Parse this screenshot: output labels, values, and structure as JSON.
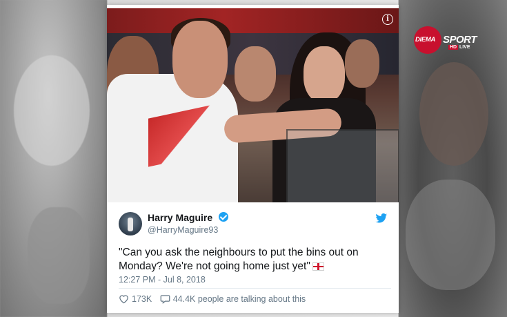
{
  "channel_logo": {
    "brand": "DIEMA",
    "name": "SPORT",
    "hd": "HD",
    "live": "LIVE",
    "color": "#c8102e"
  },
  "tweet": {
    "display_name": "Harry Maguire",
    "handle": "@HarryMaguire93",
    "text": "\"Can you ask the neighbours to put the bins out on Monday? We're not going home just yet\"",
    "timestamp": "12:27 PM - Jul 8, 2018",
    "likes": "173K",
    "replies": "44.4K people are talking about this",
    "verified_icon": "verified-badge-icon",
    "platform_icon": "twitter-bird-icon",
    "accent_color": "#1da1f2"
  }
}
